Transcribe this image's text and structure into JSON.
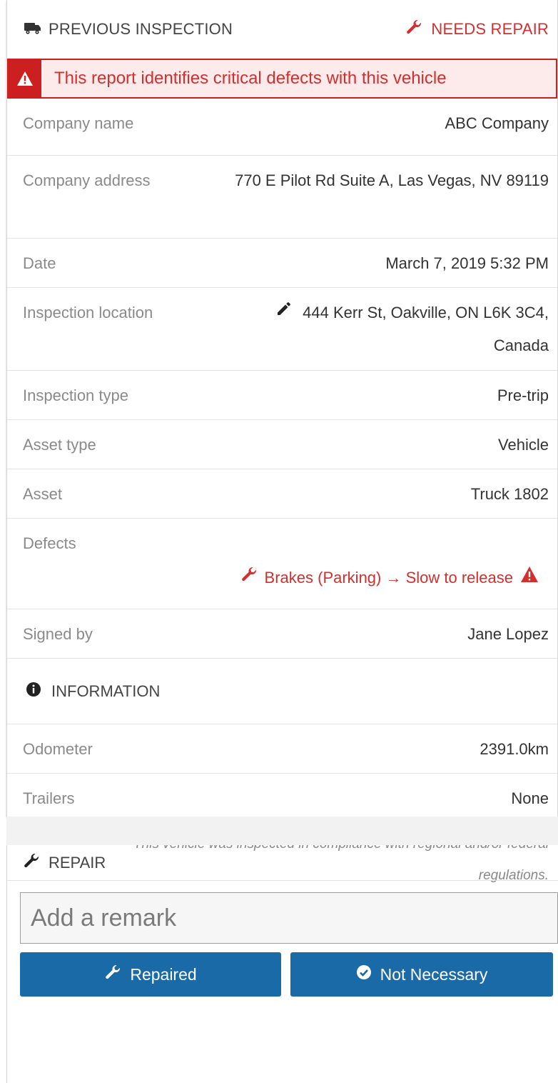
{
  "header": {
    "title": "PREVIOUS INSPECTION",
    "status": "NEEDS REPAIR"
  },
  "alert": {
    "text": "This report identifies critical defects with this vehicle"
  },
  "details": {
    "company_name": {
      "label": "Company name",
      "value": "ABC Company"
    },
    "company_address": {
      "label": "Company address",
      "value": "770 E Pilot Rd Suite A, Las Vegas, NV 89119"
    },
    "date": {
      "label": "Date",
      "value": "March 7, 2019 5:32 PM"
    },
    "inspection_location": {
      "label": "Inspection location",
      "value": "444 Kerr St, Oakville, ON L6K 3C4, Canada"
    },
    "inspection_type": {
      "label": "Inspection type",
      "value": "Pre-trip"
    },
    "asset_type": {
      "label": "Asset type",
      "value": "Vehicle"
    },
    "asset": {
      "label": "Asset",
      "value": "Truck 1802"
    },
    "defects": {
      "label": "Defects",
      "item": "Brakes (Parking) → Slow to release"
    },
    "signed_by": {
      "label": "Signed by",
      "value": "Jane Lopez"
    }
  },
  "information": {
    "title": "INFORMATION",
    "odometer": {
      "label": "Odometer",
      "value": "2391.0km"
    },
    "trailers": {
      "label": "Trailers",
      "value": "None"
    },
    "compliance": "This vehicle was inspected in compliance with regional and/or federal regulations."
  },
  "repair": {
    "title": "REPAIR",
    "remark_placeholder": "Add a remark",
    "repaired_label": "Repaired",
    "not_necessary_label": "Not Necessary"
  },
  "colors": {
    "danger": "#d32f2f",
    "primary": "#1a6aa8"
  },
  "icons": [
    "truck-icon",
    "wrench-icon",
    "warning-icon",
    "pencil-icon",
    "info-icon",
    "check-circle-icon"
  ]
}
